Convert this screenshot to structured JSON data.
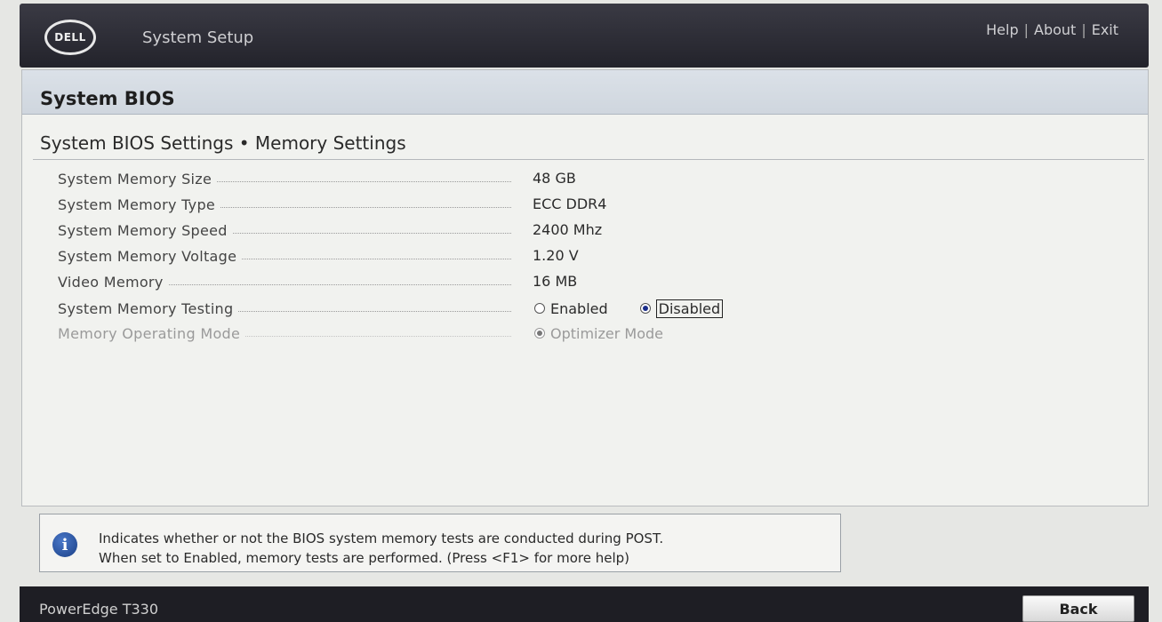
{
  "header": {
    "logo": "DELL",
    "app_title": "System Setup",
    "links": {
      "help": "Help",
      "about": "About",
      "exit": "Exit",
      "separator": "|"
    }
  },
  "section": {
    "title": "System BIOS",
    "subtitle": "System BIOS Settings • Memory Settings"
  },
  "settings": [
    {
      "label": "System Memory Size",
      "value": "48 GB"
    },
    {
      "label": "System Memory Type",
      "value": "ECC DDR4"
    },
    {
      "label": "System Memory Speed",
      "value": "2400 Mhz"
    },
    {
      "label": "System Memory Voltage",
      "value": "1.20 V"
    },
    {
      "label": "Video Memory",
      "value": "16 MB"
    },
    {
      "label": "System Memory Testing",
      "options": [
        "Enabled",
        "Disabled"
      ],
      "selected": "Disabled"
    },
    {
      "label": "Memory Operating Mode",
      "options": [
        "Optimizer Mode"
      ],
      "selected": "Optimizer Mode",
      "disabled": true
    }
  ],
  "help": {
    "icon": "info-icon",
    "line1": "Indicates whether or not the BIOS system memory tests are conducted during POST.",
    "line2": "When set to Enabled, memory tests are performed. (Press <F1> for more help)"
  },
  "footer": {
    "model": "PowerEdge T330",
    "back_label": "Back"
  },
  "colors": {
    "header_bg": "#2a2a32",
    "section_bar": "#d4dbe2",
    "radio_selected": "#1a2d8a"
  }
}
